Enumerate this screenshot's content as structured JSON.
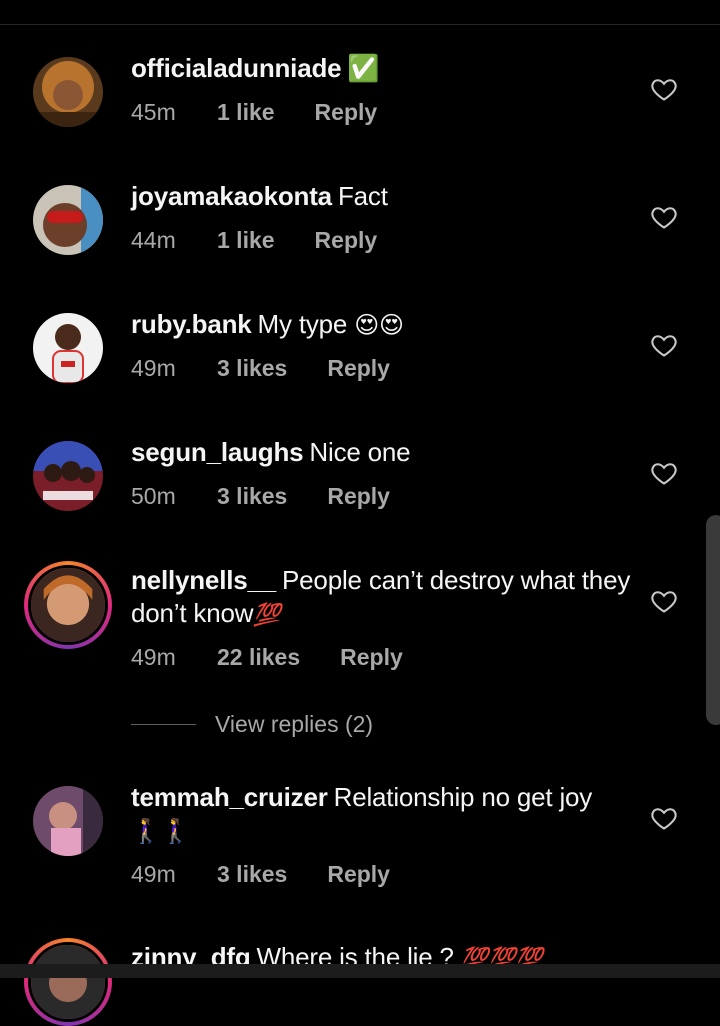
{
  "comments": [
    {
      "username": "officialadunniade",
      "text": "",
      "badge": "✅",
      "time": "45m",
      "likes": "1 like",
      "reply": "Reply"
    },
    {
      "username": "joyamakaokonta",
      "text": "Fact",
      "time": "44m",
      "likes": "1 like",
      "reply": "Reply"
    },
    {
      "username": "ruby.bank",
      "text": "My type",
      "emoji": "😍😍",
      "time": "49m",
      "likes": "3 likes",
      "reply": "Reply"
    },
    {
      "username": "segun_laughs",
      "text": "Nice one",
      "time": "50m",
      "likes": "3 likes",
      "reply": "Reply"
    },
    {
      "username": "nellynells__",
      "text": "People can’t destroy what they don’t know",
      "emoji": "💯",
      "time": "49m",
      "likes": "22 likes",
      "reply": "Reply"
    },
    {
      "username": "temmah_cruizer",
      "text": "Relationship no get joy",
      "emoji": "🚶‍♀️🚶‍♀️",
      "time": "49m",
      "likes": "3 likes",
      "reply": "Reply"
    },
    {
      "username": "zinny_dfg",
      "text": "Where is the lie ?",
      "emoji": "💯💯💯"
    }
  ],
  "view_replies": "View replies (2)",
  "colors": {
    "background": "#000000",
    "text": "#f5f5f5",
    "secondary": "#a8a8a8"
  }
}
